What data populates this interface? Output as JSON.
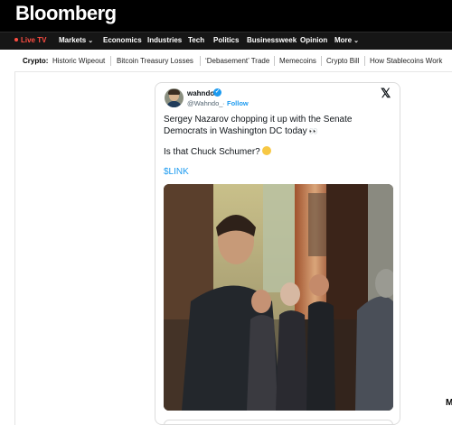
{
  "header": {
    "logo": "Bloomberg"
  },
  "nav": {
    "live": "Live TV",
    "items": [
      "Markets",
      "Economics",
      "Industries",
      "Tech",
      "Politics",
      "Businessweek",
      "Opinion",
      "More"
    ]
  },
  "topics": {
    "label": "Crypto:",
    "items": [
      "Historic Wipeout",
      "Bitcoin Treasury Losses",
      "‘Debasement’ Trade",
      "Memecoins",
      "Crypto Bill",
      "How Stablecoins Work"
    ]
  },
  "tweet": {
    "author_name": "wahndo",
    "handle": "@Wahndo_",
    "separator": "·",
    "follow_label": "Follow",
    "line1": "Sergey Nazarov chopping it up with the Senate Democrats in Washington DC today",
    "line2": "Is that Chuck Schumer?",
    "cashtag": "$LINK",
    "x_logo": "𝕏"
  },
  "sidebar_fragment": "M",
  "colors": {
    "live": "#ff4d42",
    "link": "#1d9bf0"
  },
  "icons": [
    "chevron-down-icon",
    "verified-badge-icon",
    "x-logo-icon",
    "eyes-emoji-icon",
    "grin-emoji-icon"
  ]
}
